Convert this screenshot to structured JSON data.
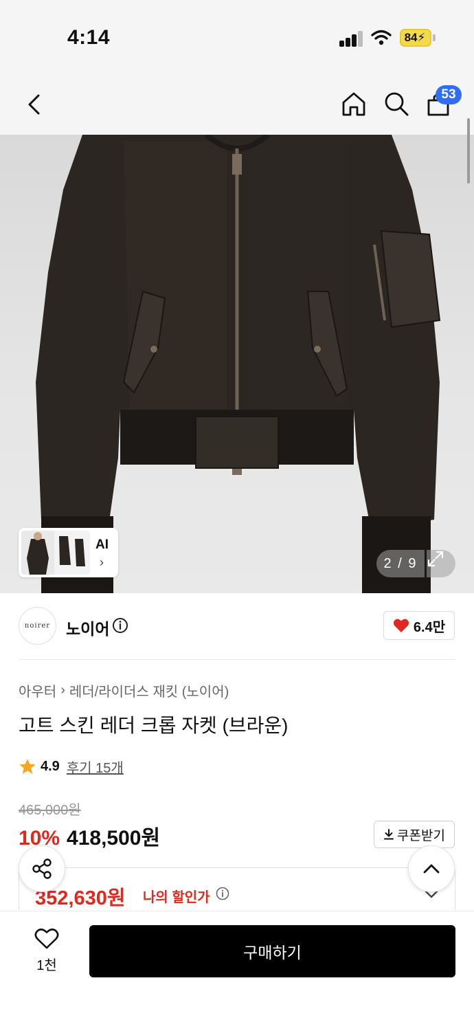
{
  "status_bar": {
    "time": "4:14",
    "battery": "84",
    "battery_color": "#f4d94a"
  },
  "header": {
    "icons": [
      "back-icon",
      "home-icon",
      "search-icon",
      "cart-icon"
    ],
    "cart_badge": "53",
    "badge_color": "#2f6ef2"
  },
  "gallery": {
    "thumbnail_label": "AI",
    "thumbnail_chevron": "›",
    "page_indicator": "2 / 9",
    "expand_icon": "expand-icon"
  },
  "brand": {
    "logo_text": "noirer",
    "name": "노이어",
    "info_icon": "info-icon",
    "like_count": "6.4만",
    "like_color": "#e0281f"
  },
  "product": {
    "breadcrumb": [
      "아우터",
      "레더/라이더스 재킷 (노이어)"
    ],
    "title": "고트 스킨 레더 크롭 자켓 (브라운)",
    "rating": "4.9",
    "review_link": "후기 15개",
    "star_color": "#f5a623"
  },
  "price": {
    "original": "465,000원",
    "discount_rate": "10%",
    "sale_price": "418,500원",
    "coupon_label": "쿠폰받기",
    "my_price": "352,630원",
    "my_price_label": "나의 할인가",
    "accent_color": "#e0281f"
  },
  "bottom_bar": {
    "wish_count": "1천",
    "buy_label": "구매하기"
  }
}
